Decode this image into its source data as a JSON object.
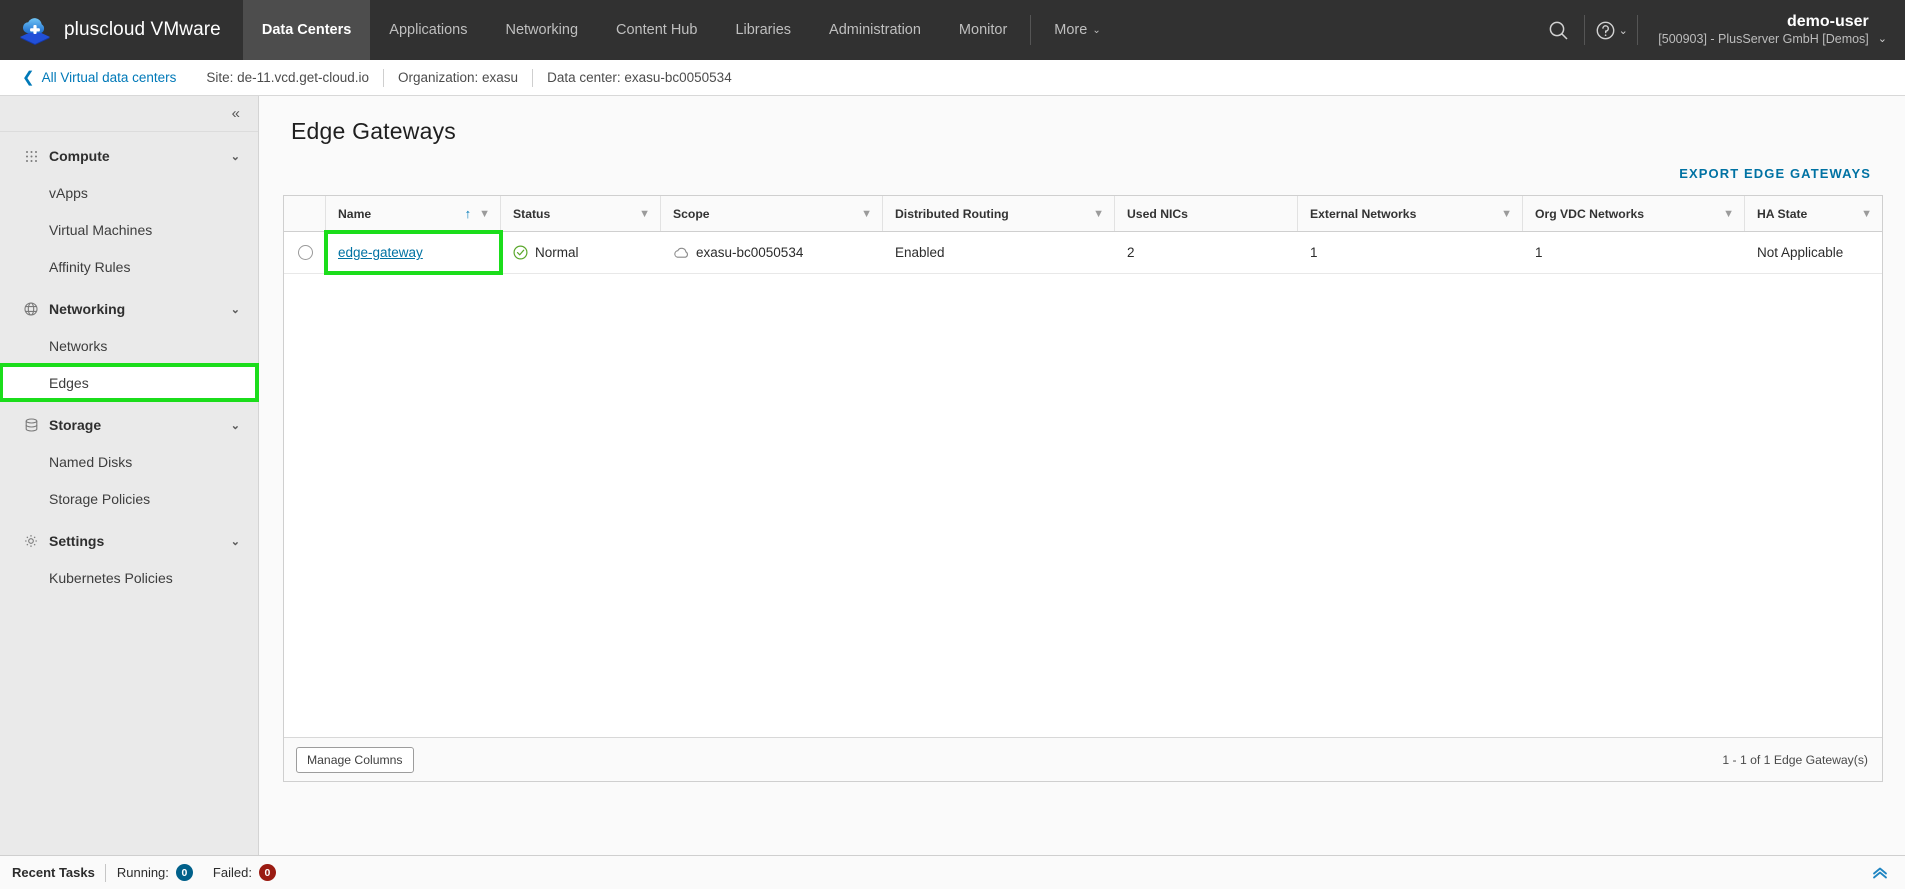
{
  "header": {
    "brand": "pluscloud VMware",
    "logo_icon": "cloud-plus-logo",
    "nav": [
      {
        "label": "Data Centers",
        "active": true
      },
      {
        "label": "Applications",
        "active": false
      },
      {
        "label": "Networking",
        "active": false
      },
      {
        "label": "Content Hub",
        "active": false
      },
      {
        "label": "Libraries",
        "active": false
      },
      {
        "label": "Administration",
        "active": false
      },
      {
        "label": "Monitor",
        "active": false
      },
      {
        "label": "More",
        "active": false,
        "caret": "⌄"
      }
    ],
    "search_icon": "search-icon",
    "help_icon": "help-circle-icon",
    "help_caret": "⌄",
    "user_name": "demo-user",
    "user_org": "[500903] - PlusServer GmbH [Demos]",
    "user_caret": "⌄"
  },
  "breadcrumb": {
    "back_chevron": "❮",
    "back_label": "All Virtual data centers",
    "segments": [
      "Site:  de-11.vcd.get-cloud.io",
      "Organization:  exasu",
      "Data center:  exasu-bc0050534"
    ]
  },
  "sidebar": {
    "collapse_icon": "«",
    "groups": [
      {
        "label": "Compute",
        "icon": "grid-dots-icon",
        "caret": "⌄",
        "items": [
          {
            "label": "vApps",
            "highlight": false
          },
          {
            "label": "Virtual Machines",
            "highlight": false
          },
          {
            "label": "Affinity Rules",
            "highlight": false
          }
        ]
      },
      {
        "label": "Networking",
        "icon": "network-globe-icon",
        "caret": "⌄",
        "items": [
          {
            "label": "Networks",
            "highlight": false
          },
          {
            "label": "Edges",
            "highlight": true
          }
        ]
      },
      {
        "label": "Storage",
        "icon": "database-icon",
        "caret": "⌄",
        "items": [
          {
            "label": "Named Disks",
            "highlight": false
          },
          {
            "label": "Storage Policies",
            "highlight": false
          }
        ]
      },
      {
        "label": "Settings",
        "icon": "gear-icon",
        "caret": "⌄",
        "items": [
          {
            "label": "Kubernetes Policies",
            "highlight": false
          }
        ]
      }
    ]
  },
  "main": {
    "page_title": "Edge Gateways",
    "export_label": "EXPORT EDGE GATEWAYS",
    "table": {
      "columns": [
        {
          "label": "Name",
          "sort": "↑",
          "filter": true
        },
        {
          "label": "Status",
          "filter": true
        },
        {
          "label": "Scope",
          "filter": true
        },
        {
          "label": "Distributed Routing",
          "filter": true
        },
        {
          "label": "Used NICs",
          "filter": false
        },
        {
          "label": "External Networks",
          "filter": true
        },
        {
          "label": "Org VDC Networks",
          "filter": true
        },
        {
          "label": "HA State",
          "filter": true
        }
      ],
      "filter_glyph": "▼",
      "rows": [
        {
          "name": "edge-gateway",
          "name_highlight": true,
          "status": "Normal",
          "status_icon": "check-circle-icon",
          "scope": "exasu-bc0050534",
          "scope_icon": "cloud-icon",
          "distributed_routing": "Enabled",
          "used_nics": "2",
          "external_networks": "1",
          "org_vdc_networks": "1",
          "ha_state": "Not Applicable"
        }
      ],
      "manage_columns_label": "Manage Columns",
      "pager_text": "1 - 1 of 1 Edge Gateway(s)"
    }
  },
  "footer": {
    "title": "Recent Tasks",
    "running_label": "Running:",
    "running_count": "0",
    "failed_label": "Failed:",
    "failed_count": "0",
    "expand_icon": "chevron-double-up-icon"
  },
  "colors": {
    "accent_link": "#0072a3",
    "highlight_green": "#1bdd1b",
    "status_ok": "#5aa72b",
    "header_bg": "#313131",
    "running_badge": "#00608a",
    "failed_badge": "#9a1b12"
  }
}
